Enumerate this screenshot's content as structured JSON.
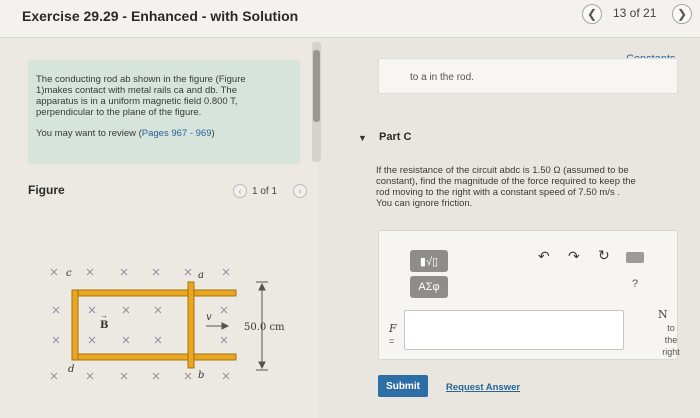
{
  "header": {
    "title": "Exercise 29.29 - Enhanced - with Solution",
    "prev_icon": "chevron-left-icon",
    "next_icon": "chevron-right-icon",
    "position": "13 of 21",
    "constants_link": "Constants"
  },
  "problem": {
    "text_line1": "The conducting rod ab shown in the figure (Figure",
    "text_line2": "1)makes contact with metal rails ca and db. The",
    "text_line3": "apparatus is in a uniform magnetic field 0.800 T,",
    "text_line4": "perpendicular to the plane of the figure.",
    "review_prefix": "You may want to review (",
    "review_link": "Pages 967 - 969",
    "review_suffix": ")"
  },
  "figure": {
    "label": "Figure",
    "count": "1 of 1",
    "labels": {
      "c": "c",
      "a": "a",
      "d": "d",
      "b": "b",
      "B": "B",
      "v": "v",
      "length": "50.0 cm"
    }
  },
  "previous_answer": {
    "text": "to a in the rod."
  },
  "part_c": {
    "label": "Part C",
    "q_line1": "If the resistance of the circuit abdc is 1.50 Ω (assumed to be",
    "q_line2": "constant), find the magnitude of the force required to keep the",
    "q_line3": "rod moving to the right with a constant speed of 7.50 m/s .",
    "q_line4": "You can ignore friction."
  },
  "editor": {
    "btn_templates": "▮√▯",
    "btn_symbols": "ΑΣφ",
    "undo_icon": "undo-icon",
    "redo_icon": "redo-icon",
    "reset_icon": "reset-icon",
    "keyboard_icon": "keyboard-icon",
    "help": "?",
    "variable": "F",
    "equals": "=",
    "input_value": "",
    "unit": "N",
    "unit_note1": "to",
    "unit_note2": "the",
    "unit_note3": "right"
  },
  "actions": {
    "submit": "Submit",
    "request_answer": "Request Answer"
  },
  "colors": {
    "accent": "#2e6ea6",
    "problem_bg": "#d6e4dc",
    "rod": "#e9a620"
  }
}
